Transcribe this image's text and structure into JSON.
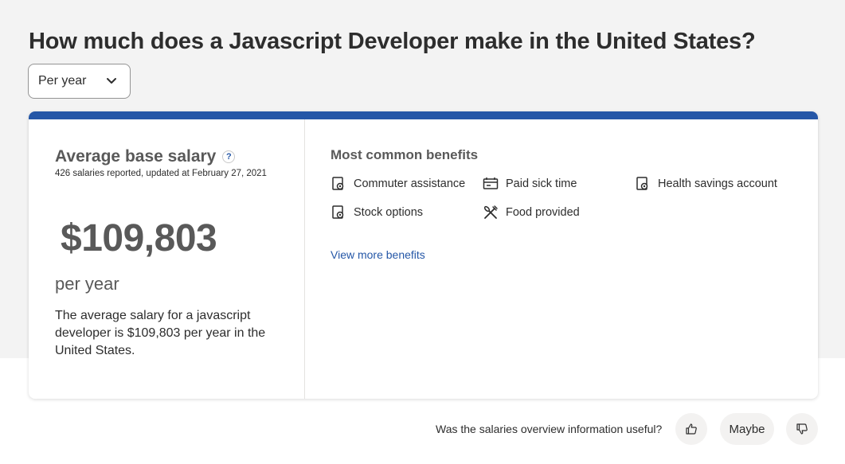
{
  "page": {
    "title": "How much does a Javascript Developer make in the United States?"
  },
  "period_select": {
    "selected": "Per year",
    "icon": "chevron-down-icon"
  },
  "colors": {
    "accent_bar": "#2557a7",
    "link": "#2557a7",
    "background": "#f3f3f3"
  },
  "salary": {
    "title": "Average base salary",
    "help_icon": "?",
    "reported": "426 salaries reported, updated at February 27, 2021",
    "amount": "$109,803",
    "period": "per year",
    "description": "The average salary for a javascript developer is $109,803 per year in the United States."
  },
  "benefits": {
    "title": "Most common benefits",
    "items": [
      {
        "label": "Commuter assistance",
        "icon": "benefit-document-icon"
      },
      {
        "label": "Paid sick time",
        "icon": "calendar-icon"
      },
      {
        "label": "Health savings account",
        "icon": "benefit-document-icon"
      },
      {
        "label": "Stock options",
        "icon": "benefit-document-icon"
      },
      {
        "label": "Food provided",
        "icon": "utensils-icon"
      }
    ],
    "view_more": "View more benefits"
  },
  "feedback": {
    "question": "Was the salaries overview information useful?",
    "thumbs_up_icon": "thumbs-up-icon",
    "maybe_label": "Maybe",
    "thumbs_down_icon": "thumbs-down-icon"
  }
}
